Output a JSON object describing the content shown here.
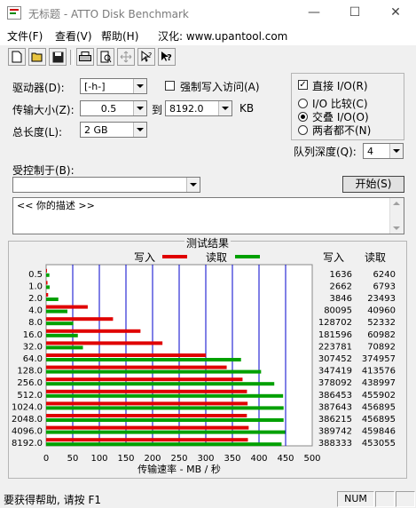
{
  "window": {
    "title": "无标题 - ATTO Disk Benchmark",
    "minimize": "—",
    "maximize": "☐",
    "close": "✕"
  },
  "menu": {
    "file": "文件(F)",
    "view": "查看(V)",
    "help": "帮助(H)",
    "localized": "汉化: www.upantool.com"
  },
  "toolbar": {
    "icons": [
      "new-file-icon",
      "open-folder-icon",
      "save-icon",
      "print-icon",
      "print-preview-icon",
      "move-icon",
      "context-help-icon",
      "help-icon"
    ]
  },
  "form": {
    "drive_label": "驱动器(D):",
    "drive_value": "[-h-]",
    "force_write_label": "强制写入访问(A)",
    "transfer_label": "传输大小(Z):",
    "transfer_from": "0.5",
    "to_label": "到",
    "transfer_to": "8192.0",
    "kb_label": "KB",
    "length_label": "总长度(L):",
    "length_value": "2 GB",
    "direct_io_label": "直接 I/O(R)",
    "direct_io_checked": true,
    "io_compare_label": "I/O 比较(C)",
    "overlap_io_label": "交叠 I/O(O)",
    "neither_label": "两者都不(N)",
    "queue_label": "队列深度(Q):",
    "queue_value": "4",
    "controlled_label": "受控制于(B):",
    "controlled_value": "",
    "start_button": "开始(S)",
    "description": "<<  你的描述  >>"
  },
  "results": {
    "title": "测试结果",
    "legend_write": "写入",
    "legend_read": "读取",
    "col_write": "写入",
    "col_read": "读取"
  },
  "colors": {
    "write": "#e00000",
    "read": "#00a000",
    "grid": "#0000cc"
  },
  "chart_data": {
    "type": "bar",
    "orientation": "horizontal",
    "title": "测试结果",
    "xlabel": "传输速率 - MB / 秒",
    "ylabel": "",
    "xlim": [
      0,
      500
    ],
    "xticks": [
      0,
      50,
      100,
      150,
      200,
      250,
      300,
      350,
      400,
      450,
      500
    ],
    "categories": [
      "0.5",
      "1.0",
      "2.0",
      "4.0",
      "8.0",
      "16.0",
      "32.0",
      "64.0",
      "128.0",
      "256.0",
      "512.0",
      "1024.0",
      "2048.0",
      "4096.0",
      "8192.0"
    ],
    "series": [
      {
        "name": "写入",
        "values": [
          1.6,
          2.6,
          3.8,
          78.2,
          125.7,
          177.3,
          218.6,
          300.2,
          339.3,
          369.1,
          377.4,
          378.6,
          377.2,
          380.6,
          379.2
        ],
        "labels": [
          "1636",
          "2662",
          "3846",
          "80095",
          "128702",
          "181596",
          "223781",
          "307452",
          "347419",
          "378092",
          "386453",
          "387643",
          "386215",
          "389742",
          "388333"
        ]
      },
      {
        "name": "读取",
        "values": [
          6.1,
          6.6,
          22.9,
          40.0,
          51.1,
          59.6,
          69.2,
          366.2,
          403.9,
          428.7,
          445.3,
          446.2,
          446.2,
          449.1,
          442.4
        ],
        "labels": [
          "6240",
          "6793",
          "23493",
          "40960",
          "52332",
          "60982",
          "70892",
          "374957",
          "413576",
          "438997",
          "455902",
          "456895",
          "456895",
          "459846",
          "453055"
        ]
      }
    ]
  },
  "status": {
    "help_text": "要获得帮助, 请按 F1",
    "num": "NUM"
  }
}
